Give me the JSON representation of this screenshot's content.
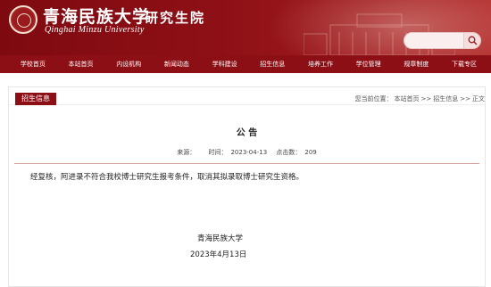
{
  "header": {
    "school_name": "青海民族大学",
    "school_name_en": "Qinghai Minzu University",
    "department": "研究生院",
    "search": {
      "placeholder": "",
      "value": ""
    }
  },
  "nav": {
    "items": [
      "学校首页",
      "本站首页",
      "内设机构",
      "新闻动态",
      "学科建设",
      "招生信息",
      "培养工作",
      "学位管理",
      "规章制度",
      "下载专区"
    ]
  },
  "breadcrumb": {
    "category_tab": "招生信息",
    "prefix": "您当前位置：",
    "items": [
      "本站首页",
      ">>",
      "招生信息",
      ">>",
      "正文"
    ]
  },
  "article": {
    "title": "公 告",
    "source_label": "来源：",
    "source_value": "",
    "time_label": "时间：",
    "time_value": "2023-04-13",
    "clicks_label": "点击数：",
    "clicks_value": "209",
    "body": "经复核，阿进录不符合我校博士研究生报考条件，取消其拟录取博士研究生资格。",
    "sign_org": "青海民族大学",
    "sign_date": "2023年4月13日"
  },
  "colors": {
    "brand_red": "#8d0f16",
    "header_red": "#7e0a10"
  }
}
